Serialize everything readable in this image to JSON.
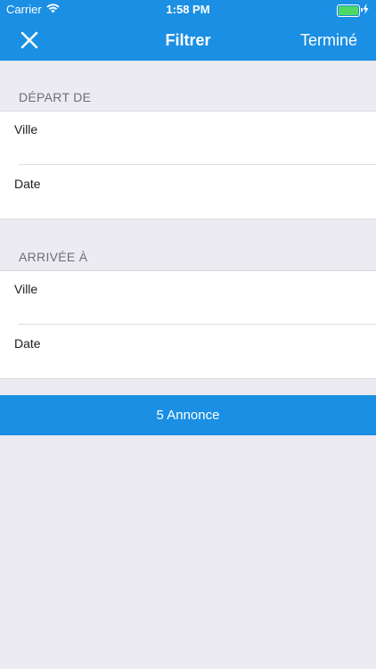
{
  "status_bar": {
    "carrier": "Carrier",
    "time": "1:58 PM",
    "battery_level": 1.0,
    "battery_color": "#4cd964"
  },
  "nav": {
    "title": "Filtrer",
    "done_label": "Terminé",
    "close_icon": "close-icon"
  },
  "departure": {
    "header": "DÉPART DE",
    "city_label": "Ville",
    "date_label": "Date"
  },
  "arrival": {
    "header": "ARRIVÉE À",
    "city_label": "Ville",
    "date_label": "Date"
  },
  "results_button": {
    "label": "5 Annonce"
  },
  "colors": {
    "accent": "#1a8fe3",
    "background": "#ebebf1"
  }
}
